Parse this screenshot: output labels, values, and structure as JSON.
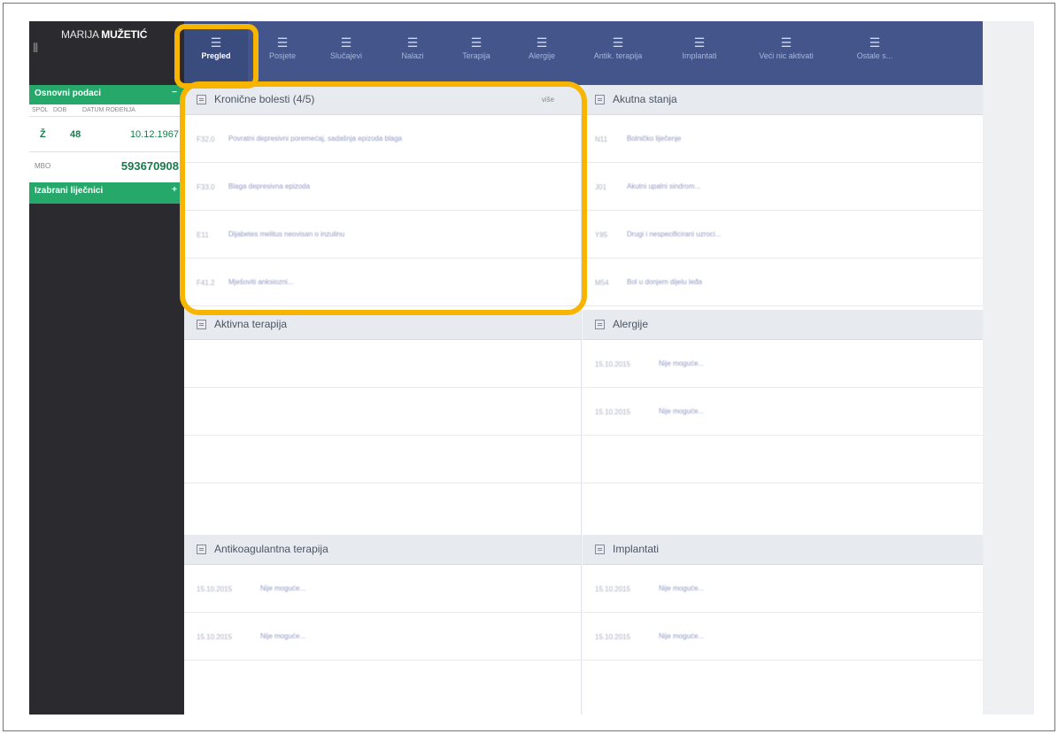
{
  "patient": {
    "first": "MARIJA",
    "last": "MUŽETIĆ",
    "menu_glyph": "⦀"
  },
  "sidebar": {
    "basic_title": "Osnovni podaci",
    "basic_toggle": "−",
    "col_sex": "SPOL",
    "col_age": "DOB",
    "col_dob": "DATUM ROĐENJA",
    "sex": "Ž",
    "age": "48",
    "dob": "10.12.1967",
    "mbo_label": "MBO",
    "mbo": "593670908",
    "doctors_title": "Izabrani liječnici",
    "doctors_toggle": "+"
  },
  "nav": {
    "items": [
      {
        "label": "Pregled",
        "icon": "list-icon"
      },
      {
        "label": "Posjete",
        "icon": "list-icon"
      },
      {
        "label": "Slučajevi",
        "icon": "list-icon"
      },
      {
        "label": "Nalazi",
        "icon": "list-icon"
      },
      {
        "label": "Terapija",
        "icon": "list-icon"
      },
      {
        "label": "Alergije",
        "icon": "list-icon"
      },
      {
        "label": "Antik. terapija",
        "icon": "list-icon"
      },
      {
        "label": "Implantati",
        "icon": "list-icon"
      },
      {
        "label": "Veći nic aktivati",
        "icon": "list-icon"
      },
      {
        "label": "Ostale s...",
        "icon": "list-icon"
      }
    ]
  },
  "panels": {
    "chronic": {
      "title": "Kronične bolesti (4/5)",
      "more": "više",
      "rows": [
        {
          "code": "F32.0",
          "text": "Povratni depresivni poremećaj, sadašnja epizoda blaga"
        },
        {
          "code": "F33.0",
          "text": "Blaga depresivna epizoda"
        },
        {
          "code": "E11",
          "text": "Dijabetes melitus neovisan o inzulinu"
        },
        {
          "code": "F41.2",
          "text": "Mješoviti anksiozni..."
        }
      ]
    },
    "acute": {
      "title": "Akutna stanja",
      "rows": [
        {
          "code": "N11",
          "text": "Bolničko liječenje"
        },
        {
          "code": "J01",
          "text": "Akutni upalni sindrom..."
        },
        {
          "code": "Y85",
          "text": "Drugi i nespecificirani uzroci..."
        },
        {
          "code": "M54",
          "text": "Bol u donjem dijelu leđa"
        }
      ]
    },
    "therapy": {
      "title": "Aktivna terapija"
    },
    "allergies": {
      "title": "Alergije",
      "rows": [
        {
          "code": "15.10.2015",
          "text": "Nije moguće..."
        },
        {
          "code": "15.10.2015",
          "text": "Nije moguće..."
        }
      ]
    },
    "anticoag": {
      "title": "Antikoagulantna terapija",
      "rows": [
        {
          "code": "15.10.2015",
          "text": "Nije moguće..."
        },
        {
          "code": "15.10.2015",
          "text": "Nije moguće..."
        }
      ]
    },
    "implants": {
      "title": "Implantati",
      "rows": [
        {
          "code": "15.10.2015",
          "text": "Nije moguće..."
        },
        {
          "code": "15.10.2015",
          "text": "Nije moguće..."
        }
      ]
    }
  },
  "colors": {
    "highlight": "#f7b500",
    "nav_bg": "#43558a",
    "sidebar_bg": "#2b2b2f",
    "accent_green": "#27a86b"
  }
}
